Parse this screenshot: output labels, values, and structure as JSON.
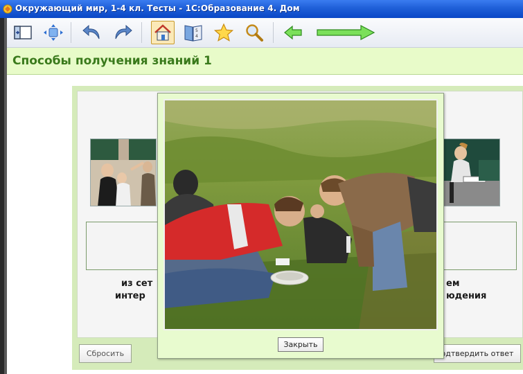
{
  "window": {
    "title": "Окружающий мир, 1-4 кл. Тесты - 1С:Образование 4. Дом"
  },
  "toolbar": {
    "buttons": [
      {
        "icon": "panel-toggle-icon"
      },
      {
        "icon": "move-icon"
      },
      {
        "icon": "undo-icon"
      },
      {
        "icon": "redo-icon"
      },
      {
        "icon": "home-icon"
      },
      {
        "icon": "contents-book-icon"
      },
      {
        "icon": "favorites-star-icon"
      },
      {
        "icon": "search-icon"
      },
      {
        "icon": "back-arrow-icon"
      },
      {
        "icon": "forward-arrow-icon"
      }
    ]
  },
  "header": {
    "title": "Способы получения знаний 1"
  },
  "task": {
    "left_caption_line1": "из сет",
    "left_caption_line2": "интер",
    "right_caption_line1": "ем",
    "right_caption_line2": "юдения",
    "reset_label": "Сбросить",
    "confirm_label": "одтвердить ответ"
  },
  "modal": {
    "close_label": "Закрыть"
  },
  "colors": {
    "titlebar": "#1f5fd8",
    "header_bg": "#e8fbc9",
    "header_text": "#3a7a1c",
    "panel_bg": "#d5ebba",
    "modal_bg": "#e8fbcf"
  }
}
